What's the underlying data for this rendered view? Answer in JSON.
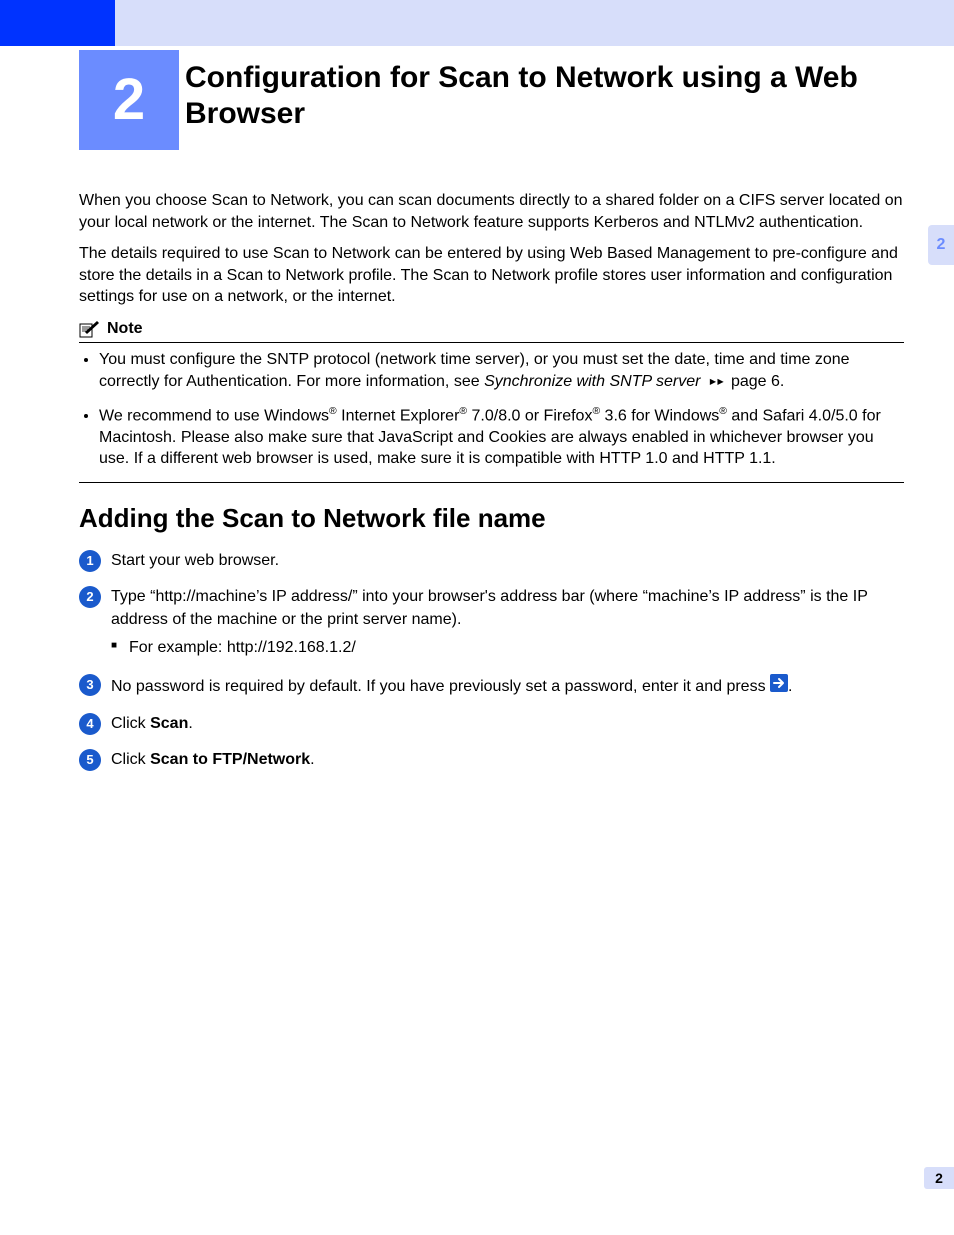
{
  "chapter": {
    "number": "2",
    "title": "Configuration for Scan to Network using a Web Browser",
    "side_tab": "2"
  },
  "intro": {
    "p1": "When you choose Scan to Network, you can scan documents directly to a shared folder on a CIFS server located on your local network or the internet. The Scan to Network feature supports Kerberos and NTLMv2 authentication.",
    "p2": "The details required to use Scan to Network can be entered by using Web Based Management to pre-configure and store the details in a Scan to Network profile. The Scan to Network profile stores user information and configuration settings for use on a network, or the internet."
  },
  "note": {
    "label": "Note",
    "items": {
      "a_pre": "You must configure the SNTP protocol (network time server), or you must set the date, time and time zone correctly for Authentication. For more information, see ",
      "a_xref": "Synchronize with SNTP server",
      "a_arrows": " ▸▸ ",
      "a_post": "page 6.",
      "b_1": "We recommend to use Windows",
      "b_2": " Internet Explorer",
      "b_3": " 7.0/8.0 or Firefox",
      "b_4": " 3.6 for Windows",
      "b_5": " and Safari 4.0/5.0 for Macintosh. Please also make sure that JavaScript and Cookies are always enabled in whichever browser you use. If a different web browser is used, make sure it is compatible with HTTP 1.0 and HTTP 1.1.",
      "reg": "®"
    }
  },
  "section": {
    "title": "Adding the Scan to Network file name",
    "steps": {
      "s1": "Start your web browser.",
      "s2": "Type “http://machine’s IP address/” into your browser's address bar (where “machine’s IP address” is the IP address of the machine or the print server name).",
      "s2_sub": "For example: http://192.168.1.2/",
      "s3_pre": "No password is required by default. If you have previously set a password, enter it and press ",
      "s3_post": ".",
      "s4_pre": "Click ",
      "s4_bold": "Scan",
      "s4_post": ".",
      "s5_pre": "Click ",
      "s5_bold": "Scan to FTP/Network",
      "s5_post": "."
    }
  },
  "page_number": "2"
}
